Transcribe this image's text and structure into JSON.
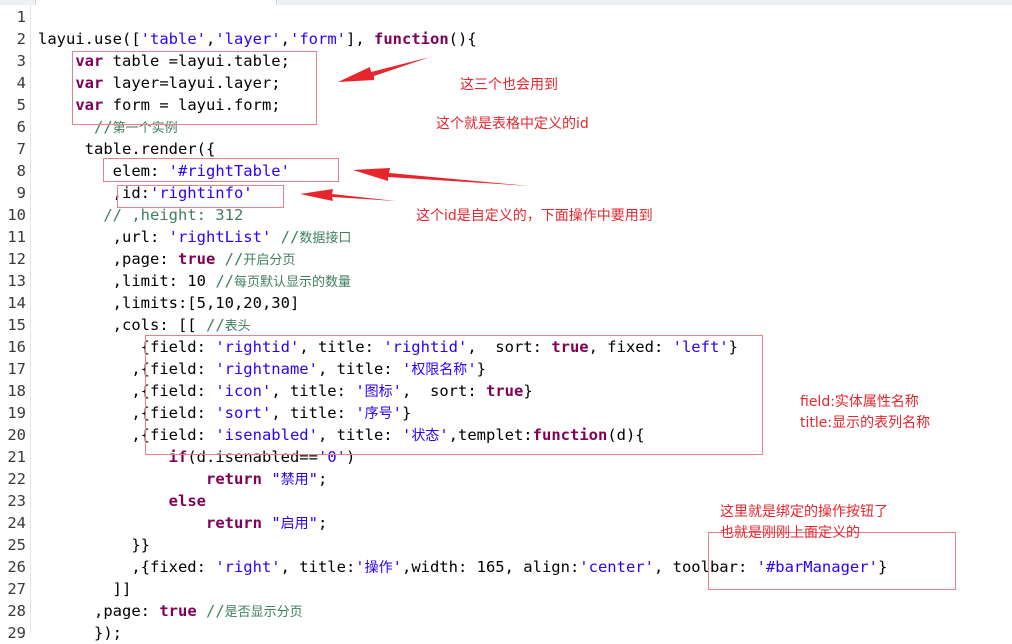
{
  "editor": {
    "line_numbers": [
      "1",
      "2",
      "3",
      "4",
      "5",
      "6",
      "7",
      "8",
      "9",
      "10",
      "11",
      "12",
      "13",
      "14",
      "15",
      "16",
      "17",
      "18",
      "19",
      "20",
      "21",
      "22",
      "23",
      "24",
      "25",
      "26",
      "27",
      "28",
      "29"
    ],
    "lines": [
      [],
      [
        [
          "p",
          "layui.use(["
        ],
        [
          "s",
          "'table'"
        ],
        [
          "p",
          ","
        ],
        [
          "s",
          "'layer'"
        ],
        [
          "p",
          ","
        ],
        [
          "s",
          "'form'"
        ],
        [
          "p",
          "], "
        ],
        [
          "k",
          "function"
        ],
        [
          "p",
          "(){"
        ]
      ],
      [
        [
          "p",
          "    "
        ],
        [
          "k",
          "var"
        ],
        [
          "p",
          " table =layui.table;"
        ]
      ],
      [
        [
          "p",
          "    "
        ],
        [
          "k",
          "var"
        ],
        [
          "p",
          " layer=layui.layer;"
        ]
      ],
      [
        [
          "p",
          "    "
        ],
        [
          "k",
          "var"
        ],
        [
          "p",
          " form = layui.form;"
        ]
      ],
      [
        [
          "p",
          "      "
        ],
        [
          "c",
          "//"
        ],
        [
          "cz",
          "第一个实例"
        ]
      ],
      [
        [
          "p",
          "     table.render({"
        ]
      ],
      [
        [
          "p",
          "        elem: "
        ],
        [
          "s",
          "'#rightTable'"
        ]
      ],
      [
        [
          "p",
          "        ,id:"
        ],
        [
          "s",
          "'rightinfo'"
        ]
      ],
      [
        [
          "p",
          "       "
        ],
        [
          "c",
          "// ,height: 312"
        ]
      ],
      [
        [
          "p",
          "        ,url: "
        ],
        [
          "s",
          "'rightList'"
        ],
        [
          "p",
          " "
        ],
        [
          "c",
          "//"
        ],
        [
          "cz",
          "数据接口"
        ]
      ],
      [
        [
          "p",
          "        ,page: "
        ],
        [
          "k",
          "true"
        ],
        [
          "p",
          " "
        ],
        [
          "c",
          "//"
        ],
        [
          "cz",
          "开启分页"
        ]
      ],
      [
        [
          "p",
          "        ,limit: 10 "
        ],
        [
          "c",
          "//"
        ],
        [
          "cz",
          "每页默认显示的数量"
        ]
      ],
      [
        [
          "p",
          "        ,limits:[5,10,20,30]"
        ]
      ],
      [
        [
          "p",
          "        ,cols: [[ "
        ],
        [
          "c",
          "//"
        ],
        [
          "cz",
          "表头"
        ]
      ],
      [
        [
          "p",
          "           {field: "
        ],
        [
          "s",
          "'rightid'"
        ],
        [
          "p",
          ", title: "
        ],
        [
          "s",
          "'rightid'"
        ],
        [
          "p",
          ",  sort: "
        ],
        [
          "k",
          "true"
        ],
        [
          "p",
          ", fixed: "
        ],
        [
          "s",
          "'left'"
        ],
        [
          "p",
          "}"
        ]
      ],
      [
        [
          "p",
          "          ,{field: "
        ],
        [
          "s",
          "'rightname'"
        ],
        [
          "p",
          ", title: "
        ],
        [
          "s",
          "'"
        ],
        [
          "sz",
          "权限名称"
        ],
        [
          "s",
          "'"
        ],
        [
          "p",
          "}"
        ]
      ],
      [
        [
          "p",
          "          ,{field: "
        ],
        [
          "s",
          "'icon'"
        ],
        [
          "p",
          ", title: "
        ],
        [
          "s",
          "'"
        ],
        [
          "sz",
          "图标"
        ],
        [
          "s",
          "'"
        ],
        [
          "p",
          ",  sort: "
        ],
        [
          "k",
          "true"
        ],
        [
          "p",
          "}"
        ]
      ],
      [
        [
          "p",
          "          ,{field: "
        ],
        [
          "s",
          "'sort'"
        ],
        [
          "p",
          ", title: "
        ],
        [
          "s",
          "'"
        ],
        [
          "sz",
          "序号"
        ],
        [
          "s",
          "'"
        ],
        [
          "p",
          "}"
        ]
      ],
      [
        [
          "p",
          "          ,{field: "
        ],
        [
          "s",
          "'isenabled'"
        ],
        [
          "p",
          ", title: "
        ],
        [
          "s",
          "'"
        ],
        [
          "sz",
          "状态"
        ],
        [
          "s",
          "'"
        ],
        [
          "p",
          ",templet:"
        ],
        [
          "k",
          "function"
        ],
        [
          "p",
          "(d){"
        ]
      ],
      [
        [
          "p",
          "              "
        ],
        [
          "k",
          "if"
        ],
        [
          "p",
          "(d.isenabled=="
        ],
        [
          "s",
          "'0'"
        ],
        [
          "p",
          ")"
        ]
      ],
      [
        [
          "p",
          "                  "
        ],
        [
          "k",
          "return"
        ],
        [
          "p",
          " "
        ],
        [
          "s",
          "\""
        ],
        [
          "sz",
          "禁用"
        ],
        [
          "s",
          "\""
        ],
        [
          "p",
          ";"
        ]
      ],
      [
        [
          "p",
          "              "
        ],
        [
          "k",
          "else"
        ]
      ],
      [
        [
          "p",
          "                  "
        ],
        [
          "k",
          "return"
        ],
        [
          "p",
          " "
        ],
        [
          "s",
          "\""
        ],
        [
          "sz",
          "启用"
        ],
        [
          "s",
          "\""
        ],
        [
          "p",
          ";"
        ]
      ],
      [
        [
          "p",
          "          }}"
        ]
      ],
      [
        [
          "p",
          "          ,{fixed: "
        ],
        [
          "s",
          "'right'"
        ],
        [
          "p",
          ", title:"
        ],
        [
          "s",
          "'"
        ],
        [
          "sz",
          "操作"
        ],
        [
          "s",
          "'"
        ],
        [
          "p",
          ",width: 165, align:"
        ],
        [
          "s",
          "'center'"
        ],
        [
          "p",
          ", toolbar: "
        ],
        [
          "s",
          "'#barManager'"
        ],
        [
          "p",
          "}"
        ]
      ],
      [
        [
          "p",
          "        ]]"
        ]
      ],
      [
        [
          "p",
          "      ,page: "
        ],
        [
          "k",
          "true"
        ],
        [
          "p",
          " "
        ],
        [
          "c",
          "//"
        ],
        [
          "cz",
          "是否显示分页"
        ]
      ],
      [
        [
          "p",
          "      });"
        ]
      ]
    ]
  },
  "annotations": {
    "note_three": "这三个也会用到",
    "note_table_id": "这个就是表格中定义的id",
    "note_custom_id": "这个id是自定义的，下面操作中要用到",
    "note_field": "field:实体属性名称",
    "note_title": "title:显示的表列名称",
    "note_toolbar_1": "这里就是绑定的操作按钮了",
    "note_toolbar_2": "也就是刚刚上面定义的"
  },
  "colors": {
    "keyword": "#7f0055",
    "string": "#2a00ff",
    "comment": "#3f7f5f",
    "annotation": "#e6252c",
    "highlight_box": "#e8808a"
  }
}
